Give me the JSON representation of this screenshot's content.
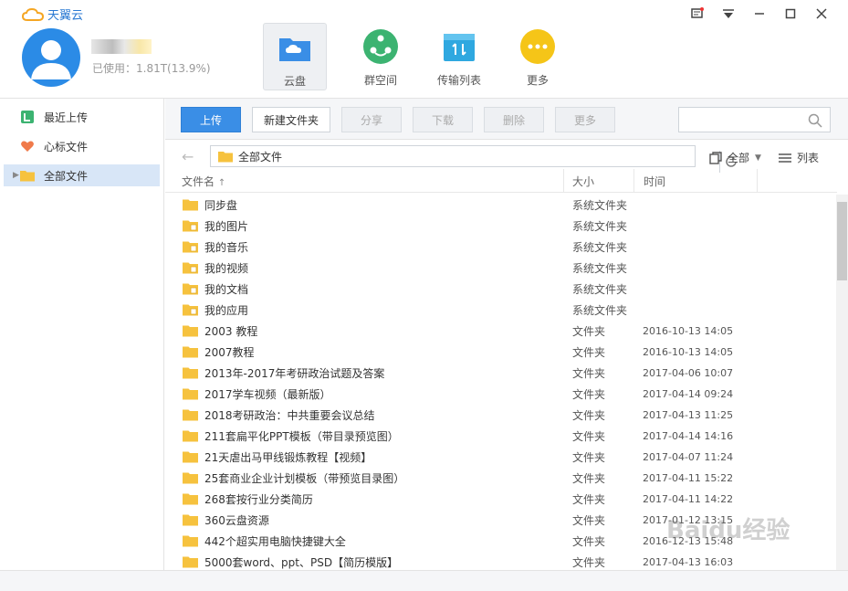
{
  "app": {
    "name": "天翼云"
  },
  "account": {
    "usage": "已使用：1.81T(13.9%)"
  },
  "nav": [
    {
      "label": "云盘",
      "icon": "cloud-folder-icon",
      "color": "#3a8ee6"
    },
    {
      "label": "群空间",
      "icon": "group-space-icon",
      "color": "#3cb371"
    },
    {
      "label": "传输列表",
      "icon": "transfer-list-icon",
      "color": "#2fa8e0"
    },
    {
      "label": "更多",
      "icon": "more-icon",
      "color": "#f5c518"
    }
  ],
  "sidebar": {
    "items": [
      {
        "label": "最近上传",
        "icon": "recent-upload-icon",
        "color": "#3cb371"
      },
      {
        "label": "心标文件",
        "icon": "heart-icon",
        "color": "#f07a4a"
      },
      {
        "label": "全部文件",
        "icon": "folder-icon",
        "color": "#f6c23e"
      }
    ]
  },
  "toolbar": {
    "upload": "上传",
    "new_folder": "新建文件夹",
    "share": "分享",
    "download": "下载",
    "delete": "删除",
    "more": "更多",
    "search_placeholder": ""
  },
  "pathbar": {
    "current": "全部文件",
    "filter": "全部",
    "view": "列表"
  },
  "columns": {
    "name": "文件名",
    "size": "大小",
    "time": "时间"
  },
  "files": [
    {
      "name": "同步盘",
      "size": "系统文件夹",
      "time": ""
    },
    {
      "name": "我的图片",
      "size": "系统文件夹",
      "time": ""
    },
    {
      "name": "我的音乐",
      "size": "系统文件夹",
      "time": ""
    },
    {
      "name": "我的视频",
      "size": "系统文件夹",
      "time": ""
    },
    {
      "name": "我的文档",
      "size": "系统文件夹",
      "time": ""
    },
    {
      "name": "我的应用",
      "size": "系统文件夹",
      "time": ""
    },
    {
      "name": "2003 教程",
      "size": "文件夹",
      "time": "2016-10-13 14:05"
    },
    {
      "name": "2007教程",
      "size": "文件夹",
      "time": "2016-10-13 14:05"
    },
    {
      "name": "2013年-2017年考研政治试题及答案",
      "size": "文件夹",
      "time": "2017-04-06 10:07"
    },
    {
      "name": "2017学车视频（最新版）",
      "size": "文件夹",
      "time": "2017-04-14 09:24"
    },
    {
      "name": "2018考研政治：中共重要会议总结",
      "size": "文件夹",
      "time": "2017-04-13 11:25"
    },
    {
      "name": "211套扁平化PPT模板（带目录预览图）",
      "size": "文件夹",
      "time": "2017-04-14 14:16"
    },
    {
      "name": "21天虐出马甲线锻炼教程【视频】",
      "size": "文件夹",
      "time": "2017-04-07 11:24"
    },
    {
      "name": "25套商业企业计划模板（带预览目录图）",
      "size": "文件夹",
      "time": "2017-04-11 15:22"
    },
    {
      "name": "268套按行业分类简历",
      "size": "文件夹",
      "time": "2017-04-11 14:22"
    },
    {
      "name": "360云盘资源",
      "size": "文件夹",
      "time": "2017-01-12 13:15"
    },
    {
      "name": "442个超实用电脑快捷键大全",
      "size": "文件夹",
      "time": "2016-12-13 15:48"
    },
    {
      "name": "5000套word、ppt、PSD【简历模版】",
      "size": "文件夹",
      "time": "2017-04-13 16:03"
    }
  ],
  "watermark": "Baidu经验"
}
